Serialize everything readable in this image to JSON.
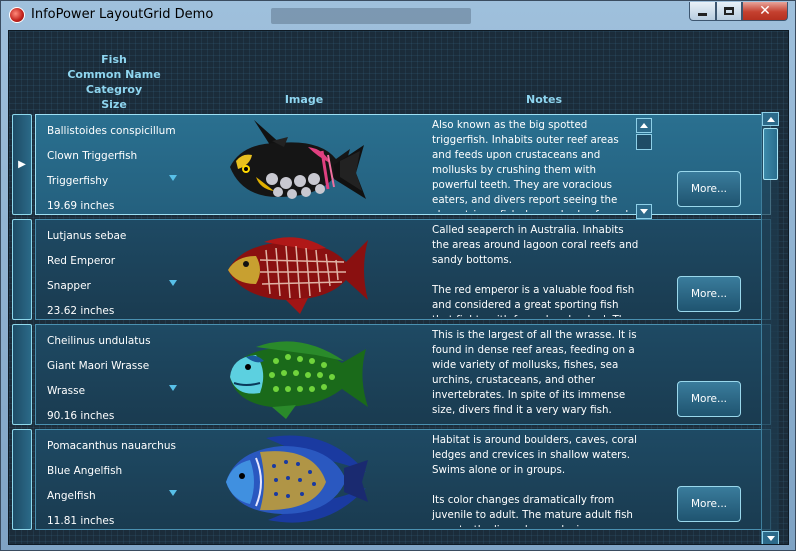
{
  "window": {
    "title": "InfoPower LayoutGrid Demo"
  },
  "headers": {
    "fish_lines": [
      "Fish",
      "Common Name",
      "Categroy",
      "Size"
    ],
    "image": "Image",
    "notes": "Notes"
  },
  "rows": [
    {
      "species": "Ballistoides conspicillum",
      "common_name": "Clown Triggerfish",
      "category": "Triggerfishy",
      "size": "19.69 inches",
      "notes": "Also known as the big spotted triggerfish.  Inhabits outer reef areas and feeds upon crustaceans and mollusks by crushing them with powerful teeth.  They are voracious eaters, and divers report seeing the clown triggerfish devour beds of pearl oysters.",
      "more_label": "More...",
      "selected": true
    },
    {
      "species": "Lutjanus sebae",
      "common_name": "Red Emperor",
      "category": "Snapper",
      "size": "23.62 inches",
      "notes": "Called seaperch in Australia.  Inhabits the areas around lagoon coral reefs and sandy bottoms.\n\nThe red emperor is a valuable food fish and considered a great sporting fish that fights with fury when hooked.  The flesh of an old",
      "more_label": "More...",
      "selected": false
    },
    {
      "species": "Cheilinus undulatus",
      "common_name": "Giant Maori Wrasse",
      "category": "Wrasse",
      "size": "90.16 inches",
      "notes": "This is the largest of all the wrasse.  It is found in dense reef areas, feeding on a wide variety of mollusks, fishes, sea urchins, crustaceans, and other invertebrates. In spite of its immense size, divers find it a very wary fish.",
      "more_label": "More...",
      "selected": false
    },
    {
      "species": "Pomacanthus nauarchus",
      "common_name": "Blue Angelfish",
      "category": "Angelfish",
      "size": "11.81 inches",
      "notes": "Habitat is around boulders, caves, coral ledges and crevices in shallow waters.  Swims alone or in groups.\n\nIts color changes dramatically from juvenile to adult.  The mature adult fish can startle divers by producing a powerful drumming or",
      "more_label": "More...",
      "selected": false
    }
  ],
  "icons": {
    "app": "app-icon",
    "row_indicator": "row-pointer-icon",
    "dropdown": "chevron-down-icon"
  },
  "colors": {
    "header_text": "#8fd6f0",
    "selected_card": "#2a7090",
    "card": "#1e4a64",
    "accent": "#58c0e8"
  }
}
